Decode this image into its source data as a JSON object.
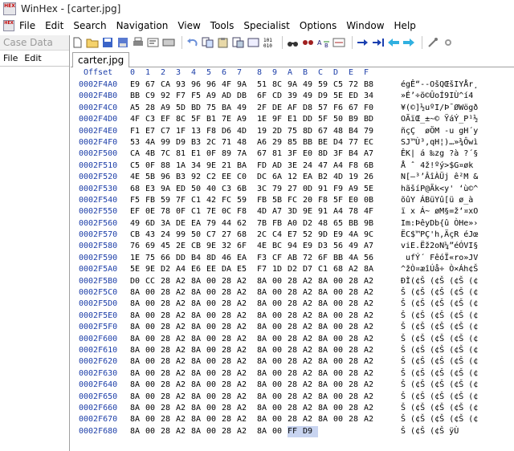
{
  "window": {
    "title": "WinHex - [carter.jpg]",
    "app_icon_text": "HEX"
  },
  "menu": [
    "File",
    "Edit",
    "Search",
    "Navigation",
    "View",
    "Tools",
    "Specialist",
    "Options",
    "Window",
    "Help"
  ],
  "case_panel": {
    "title": "Case Data",
    "menu": [
      "File",
      "Edit"
    ]
  },
  "tab": {
    "label": "carter.jpg"
  },
  "hex_header": {
    "offset_label": "Offset",
    "cols": [
      "0",
      "1",
      "2",
      "3",
      "4",
      "5",
      "6",
      "7",
      "8",
      "9",
      "A",
      "B",
      "C",
      "D",
      "E",
      "F"
    ]
  },
  "rows": [
    {
      "off": "0002F4A0",
      "hex": [
        "E9",
        "67",
        "CA",
        "93",
        "96",
        "96",
        "4F",
        "9A",
        "51",
        "8C",
        "9A",
        "49",
        "59",
        "C5",
        "72",
        "B8"
      ],
      "asc": "égÊ“--OšQŒšIYÅr¸"
    },
    {
      "off": "0002F4B0",
      "hex": [
        "BB",
        "C9",
        "92",
        "F7",
        "F5",
        "A9",
        "AD",
        "DB",
        "6F",
        "CD",
        "39",
        "49",
        "D9",
        "5E",
        "ED",
        "34"
      ],
      "asc": "»É’÷õ©­ÛoÍ9IÙ^í4"
    },
    {
      "off": "0002F4C0",
      "hex": [
        "A5",
        "28",
        "A9",
        "5D",
        "BD",
        "75",
        "BA",
        "49",
        "2F",
        "DE",
        "AF",
        "D8",
        "57",
        "F6",
        "67",
        "F0"
      ],
      "asc": "¥(©]½uºI/Þ¯ØWögð"
    },
    {
      "off": "0002F4D0",
      "hex": [
        "4F",
        "C3",
        "EF",
        "8C",
        "5F",
        "B1",
        "7E",
        "A9",
        "1E",
        "9F",
        "E1",
        "DD",
        "5F",
        "50",
        "B9",
        "BD"
      ],
      "asc": "OÃïŒ_±~© ŸáÝ_P¹½"
    },
    {
      "off": "0002F4E0",
      "hex": [
        "F1",
        "E7",
        "C7",
        "1F",
        "13",
        "F8",
        "D6",
        "4D",
        "19",
        "2D",
        "75",
        "8D",
        "67",
        "48",
        "B4",
        "79"
      ],
      "asc": "ñçÇ  øÖM -u gH´y"
    },
    {
      "off": "0002F4F0",
      "hex": [
        "53",
        "4A",
        "99",
        "D9",
        "B3",
        "2C",
        "71",
        "48",
        "A6",
        "29",
        "85",
        "BB",
        "BE",
        "D4",
        "77",
        "EC"
      ],
      "asc": "SJ™Ù³,qH¦)…»¾Ôwì"
    },
    {
      "off": "0002F500",
      "hex": [
        "CA",
        "4B",
        "7C",
        "81",
        "E1",
        "0F",
        "89",
        "7A",
        "67",
        "81",
        "3F",
        "E0",
        "8D",
        "3F",
        "B4",
        "A7"
      ],
      "asc": "ÊK| á ‰zg ?à ?´§"
    },
    {
      "off": "0002F510",
      "hex": [
        "C5",
        "0F",
        "88",
        "1A",
        "34",
        "9E",
        "21",
        "BA",
        "FD",
        "AD",
        "3E",
        "24",
        "47",
        "A4",
        "F8",
        "6B"
      ],
      "asc": "Å ˆ 4ž!ºý­>$G¤øk"
    },
    {
      "off": "0002F520",
      "hex": [
        "4E",
        "5B",
        "96",
        "B3",
        "92",
        "C2",
        "EE",
        "C0",
        "DC",
        "6A",
        "12",
        "EA",
        "B2",
        "4D",
        "19",
        "26"
      ],
      "asc": "N[–³’ÂîÀÜj ê²M &"
    },
    {
      "off": "0002F530",
      "hex": [
        "68",
        "E3",
        "9A",
        "ED",
        "50",
        "40",
        "C3",
        "6B",
        "3C",
        "79",
        "27",
        "0D",
        "91",
        "F9",
        "A9",
        "5E"
      ],
      "asc": "hãšíP@Ãk<y' ‘ù©^"
    },
    {
      "off": "0002F540",
      "hex": [
        "F5",
        "FB",
        "59",
        "7F",
        "C1",
        "42",
        "FC",
        "59",
        "FB",
        "5B",
        "FC",
        "20",
        "F8",
        "5F",
        "E0",
        "0B"
      ],
      "asc": "õûY ÁBüYû[ü ø_à "
    },
    {
      "off": "0002F550",
      "hex": [
        "EF",
        "0E",
        "78",
        "0F",
        "C1",
        "7E",
        "0C",
        "F8",
        "4D",
        "A7",
        "3D",
        "9E",
        "91",
        "A4",
        "78",
        "4F"
      ],
      "asc": "ï x Á~ øM§=ž‘¤xO"
    },
    {
      "off": "0002F560",
      "hex": [
        "49",
        "6D",
        "3A",
        "DE",
        "EA",
        "79",
        "44",
        "62",
        "7B",
        "FB",
        "A0",
        "D2",
        "48",
        "65",
        "BB",
        "9B"
      ],
      "asc": "Im:ÞêyDb{û ÒHe»›"
    },
    {
      "off": "0002F570",
      "hex": [
        "CB",
        "43",
        "24",
        "99",
        "50",
        "C7",
        "27",
        "68",
        "2C",
        "C4",
        "E7",
        "52",
        "9D",
        "E9",
        "4A",
        "9C"
      ],
      "asc": "ËC$™PÇ'h,ÄçR éJœ"
    },
    {
      "off": "0002F580",
      "hex": [
        "76",
        "69",
        "45",
        "2E",
        "CB",
        "9E",
        "32",
        "6F",
        "4E",
        "BC",
        "94",
        "E9",
        "D3",
        "56",
        "49",
        "A7"
      ],
      "asc": "viE.Ëž2oN¼”éÓVI§"
    },
    {
      "off": "0002F590",
      "hex": [
        "1E",
        "75",
        "66",
        "DD",
        "B4",
        "8D",
        "46",
        "EA",
        "F3",
        "CF",
        "AB",
        "72",
        "6F",
        "BB",
        "4A",
        "56"
      ],
      "asc": " ufÝ´ FêóÏ«ro»JV"
    },
    {
      "off": "0002F5A0",
      "hex": [
        "5E",
        "9E",
        "D2",
        "A4",
        "E6",
        "EE",
        "DA",
        "E5",
        "F7",
        "1D",
        "D2",
        "D7",
        "C1",
        "68",
        "A2",
        "8A"
      ],
      "asc": "^žÒ¤æîÚå÷ Ò×Áh¢Š"
    },
    {
      "off": "0002F5B0",
      "hex": [
        "D0",
        "CC",
        "28",
        "A2",
        "8A",
        "00",
        "28",
        "A2",
        "8A",
        "00",
        "28",
        "A2",
        "8A",
        "00",
        "28",
        "A2"
      ],
      "asc": "ÐÌ(¢Š (¢Š (¢Š (¢"
    },
    {
      "off": "0002F5C0",
      "hex": [
        "8A",
        "00",
        "28",
        "A2",
        "8A",
        "00",
        "28",
        "A2",
        "8A",
        "00",
        "28",
        "A2",
        "8A",
        "00",
        "28",
        "A2"
      ],
      "asc": "Š (¢Š (¢Š (¢Š (¢"
    },
    {
      "off": "0002F5D0",
      "hex": [
        "8A",
        "00",
        "28",
        "A2",
        "8A",
        "00",
        "28",
        "A2",
        "8A",
        "00",
        "28",
        "A2",
        "8A",
        "00",
        "28",
        "A2"
      ],
      "asc": "Š (¢Š (¢Š (¢Š (¢"
    },
    {
      "off": "0002F5E0",
      "hex": [
        "8A",
        "00",
        "28",
        "A2",
        "8A",
        "00",
        "28",
        "A2",
        "8A",
        "00",
        "28",
        "A2",
        "8A",
        "00",
        "28",
        "A2"
      ],
      "asc": "Š (¢Š (¢Š (¢Š (¢"
    },
    {
      "off": "0002F5F0",
      "hex": [
        "8A",
        "00",
        "28",
        "A2",
        "8A",
        "00",
        "28",
        "A2",
        "8A",
        "00",
        "28",
        "A2",
        "8A",
        "00",
        "28",
        "A2"
      ],
      "asc": "Š (¢Š (¢Š (¢Š (¢"
    },
    {
      "off": "0002F600",
      "hex": [
        "8A",
        "00",
        "28",
        "A2",
        "8A",
        "00",
        "28",
        "A2",
        "8A",
        "00",
        "28",
        "A2",
        "8A",
        "00",
        "28",
        "A2"
      ],
      "asc": "Š (¢Š (¢Š (¢Š (¢"
    },
    {
      "off": "0002F610",
      "hex": [
        "8A",
        "00",
        "28",
        "A2",
        "8A",
        "00",
        "28",
        "A2",
        "8A",
        "00",
        "28",
        "A2",
        "8A",
        "00",
        "28",
        "A2"
      ],
      "asc": "Š (¢Š (¢Š (¢Š (¢"
    },
    {
      "off": "0002F620",
      "hex": [
        "8A",
        "00",
        "28",
        "A2",
        "8A",
        "00",
        "28",
        "A2",
        "8A",
        "00",
        "28",
        "A2",
        "8A",
        "00",
        "28",
        "A2"
      ],
      "asc": "Š (¢Š (¢Š (¢Š (¢"
    },
    {
      "off": "0002F630",
      "hex": [
        "8A",
        "00",
        "28",
        "A2",
        "8A",
        "00",
        "28",
        "A2",
        "8A",
        "00",
        "28",
        "A2",
        "8A",
        "00",
        "28",
        "A2"
      ],
      "asc": "Š (¢Š (¢Š (¢Š (¢"
    },
    {
      "off": "0002F640",
      "hex": [
        "8A",
        "00",
        "28",
        "A2",
        "8A",
        "00",
        "28",
        "A2",
        "8A",
        "00",
        "28",
        "A2",
        "8A",
        "00",
        "28",
        "A2"
      ],
      "asc": "Š (¢Š (¢Š (¢Š (¢"
    },
    {
      "off": "0002F650",
      "hex": [
        "8A",
        "00",
        "28",
        "A2",
        "8A",
        "00",
        "28",
        "A2",
        "8A",
        "00",
        "28",
        "A2",
        "8A",
        "00",
        "28",
        "A2"
      ],
      "asc": "Š (¢Š (¢Š (¢Š (¢"
    },
    {
      "off": "0002F660",
      "hex": [
        "8A",
        "00",
        "28",
        "A2",
        "8A",
        "00",
        "28",
        "A2",
        "8A",
        "00",
        "28",
        "A2",
        "8A",
        "00",
        "28",
        "A2"
      ],
      "asc": "Š (¢Š (¢Š (¢Š (¢"
    },
    {
      "off": "0002F670",
      "hex": [
        "8A",
        "00",
        "28",
        "A2",
        "8A",
        "00",
        "28",
        "A2",
        "8A",
        "00",
        "28",
        "A2",
        "8A",
        "00",
        "28",
        "A2"
      ],
      "asc": "Š (¢Š (¢Š (¢Š (¢"
    },
    {
      "off": "0002F680",
      "hex": [
        "8A",
        "00",
        "28",
        "A2",
        "8A",
        "00",
        "28",
        "A2",
        "8A",
        "00",
        "FF",
        "D9"
      ],
      "asc": "Š (¢Š (¢Š ÿÙ",
      "sel": [
        10,
        11
      ]
    }
  ]
}
